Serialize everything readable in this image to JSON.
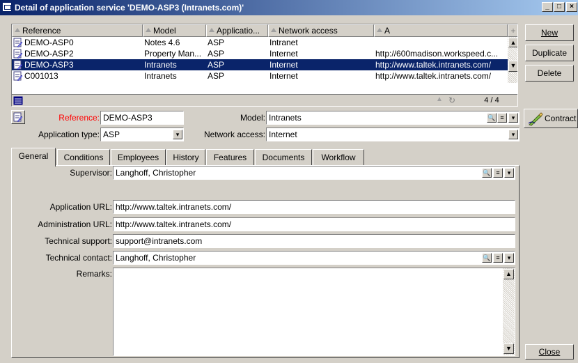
{
  "window": {
    "title": "Detail of application service 'DEMO-ASP3 (Intranets.com)'",
    "min_glyph": "_",
    "max_glyph": "□",
    "close_glyph": "×"
  },
  "grid": {
    "columns": [
      "Reference",
      "Model",
      "Applicatio...",
      "Network access",
      "A"
    ],
    "rows": [
      {
        "reference": "DEMO-ASP0",
        "model": "Notes 4.6",
        "app": "ASP",
        "network": "Intranet",
        "url": ""
      },
      {
        "reference": "DEMO-ASP2",
        "model": "Property Man...",
        "app": "ASP",
        "network": "Internet",
        "url": "http://600madison.workspeed.c..."
      },
      {
        "reference": "DEMO-ASP3",
        "model": "Intranets",
        "app": "ASP",
        "network": "Internet",
        "url": "http://www.taltek.intranets.com/"
      },
      {
        "reference": "C001013",
        "model": "Intranets",
        "app": "ASP",
        "network": "Internet",
        "url": "http://www.taltek.intranets.com/"
      }
    ],
    "record_count": "4 / 4"
  },
  "side_buttons": {
    "new": "New",
    "duplicate": "Duplicate",
    "delete": "Delete",
    "contract": "Contract",
    "close": "Close"
  },
  "header_form": {
    "reference_label": "Reference:",
    "reference_value": "DEMO-ASP3",
    "model_label": "Model:",
    "model_value": "Intranets",
    "app_type_label": "Application type:",
    "app_type_value": "ASP",
    "network_label": "Network access:",
    "network_value": "Internet"
  },
  "tabs": [
    "General",
    "Conditions",
    "Employees",
    "History",
    "Features",
    "Documents",
    "Workflow"
  ],
  "general": {
    "supervisor_label": "Supervisor:",
    "supervisor_value": "Langhoff, Christopher",
    "app_url_label": "Application URL:",
    "app_url_value": "http://www.taltek.intranets.com/",
    "admin_url_label": "Administration URL:",
    "admin_url_value": "http://www.taltek.intranets.com/",
    "tech_support_label": "Technical support:",
    "tech_support_value": "support@intranets.com",
    "tech_contact_label": "Technical contact:",
    "tech_contact_value": "Langhoff, Christopher",
    "remarks_label": "Remarks:",
    "remarks_value": ""
  },
  "colors": {
    "title_start": "#0a246a",
    "title_end": "#a6caf0",
    "selection": "#0a246a",
    "mandatory_label": "#ff0000",
    "face": "#d4d0c8"
  }
}
